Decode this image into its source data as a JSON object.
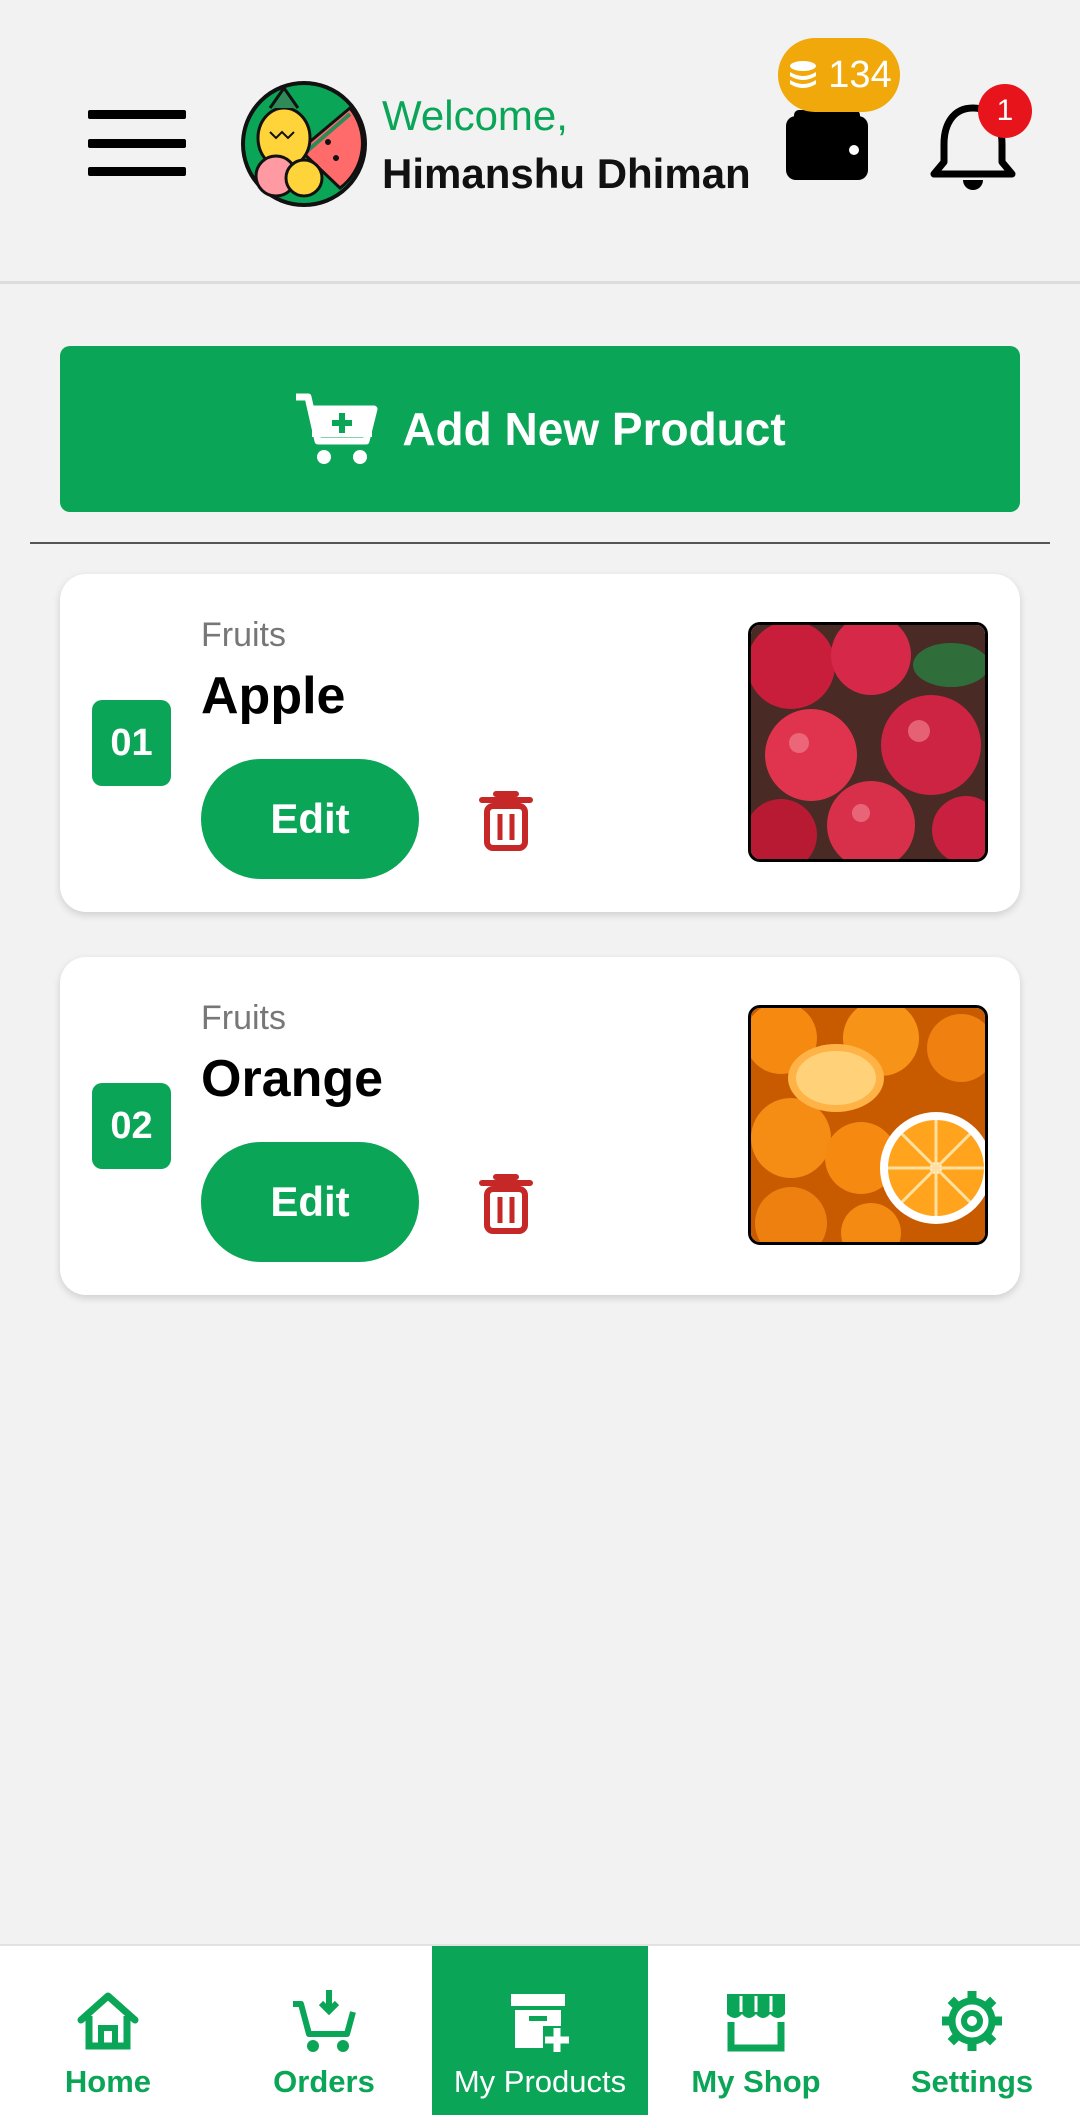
{
  "header": {
    "welcome_text": "Welcome,",
    "user_name": "Himanshu Dhiman",
    "coin_balance": "134",
    "notification_count": "1",
    "icons": [
      "menu-icon",
      "fruit-logo",
      "coins-icon",
      "wallet-icon",
      "bell-icon"
    ]
  },
  "actions": {
    "add_product_label": "Add New Product",
    "add_product_icon": "cart-plus-icon"
  },
  "products": [
    {
      "index": "01",
      "category": "Fruits",
      "name": "Apple",
      "edit_label": "Edit",
      "image": "apple-photo"
    },
    {
      "index": "02",
      "category": "Fruits",
      "name": "Orange",
      "edit_label": "Edit",
      "image": "orange-photo"
    }
  ],
  "bottom_nav": {
    "items": [
      {
        "label": "Home",
        "icon": "home-icon",
        "active": false
      },
      {
        "label": "Orders",
        "icon": "cart-download-icon",
        "active": false
      },
      {
        "label": "My Products",
        "icon": "box-plus-icon",
        "active": true
      },
      {
        "label": "My Shop",
        "icon": "shop-icon",
        "active": false
      },
      {
        "label": "Settings",
        "icon": "gear-icon",
        "active": false
      }
    ]
  },
  "colors": {
    "primary": "#0aa556",
    "coin": "#f0a80a",
    "badge": "#e8141b",
    "trash": "#c62828",
    "background": "#f2f2f2"
  }
}
